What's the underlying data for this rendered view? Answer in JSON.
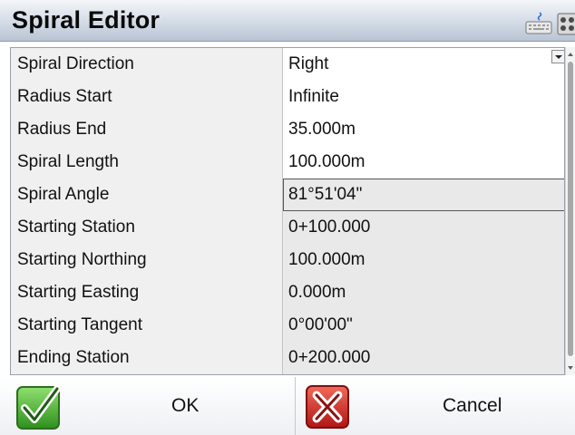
{
  "window": {
    "title": "Spiral Editor"
  },
  "toolbar_icons": [
    "keyboard-icon",
    "calculator-icon"
  ],
  "grid": {
    "rows": [
      {
        "label": "Spiral Direction",
        "value": "Right",
        "state": "editable",
        "dropdown": true
      },
      {
        "label": "Radius Start",
        "value": "Infinite",
        "state": "editable"
      },
      {
        "label": "Radius End",
        "value": "35.000m",
        "state": "editable"
      },
      {
        "label": "Spiral Length",
        "value": "100.000m",
        "state": "editable"
      },
      {
        "label": "Spiral Angle",
        "value": "81°51'04\"",
        "state": "selected"
      },
      {
        "label": "Starting Station",
        "value": "0+100.000",
        "state": "readonly"
      },
      {
        "label": "Starting Northing",
        "value": "100.000m",
        "state": "readonly"
      },
      {
        "label": "Starting Easting",
        "value": "0.000m",
        "state": "readonly"
      },
      {
        "label": "Starting Tangent",
        "value": "0°00'00\"",
        "state": "readonly"
      },
      {
        "label": "Ending Station",
        "value": "0+200.000",
        "state": "readonly"
      }
    ]
  },
  "buttons": {
    "ok_label": "OK",
    "cancel_label": "Cancel"
  },
  "colors": {
    "ok_accent": "#3fae2a",
    "cancel_accent": "#d42020",
    "readonly_cell": "#e9e9e9",
    "label_cell": "#f0f0f0"
  }
}
